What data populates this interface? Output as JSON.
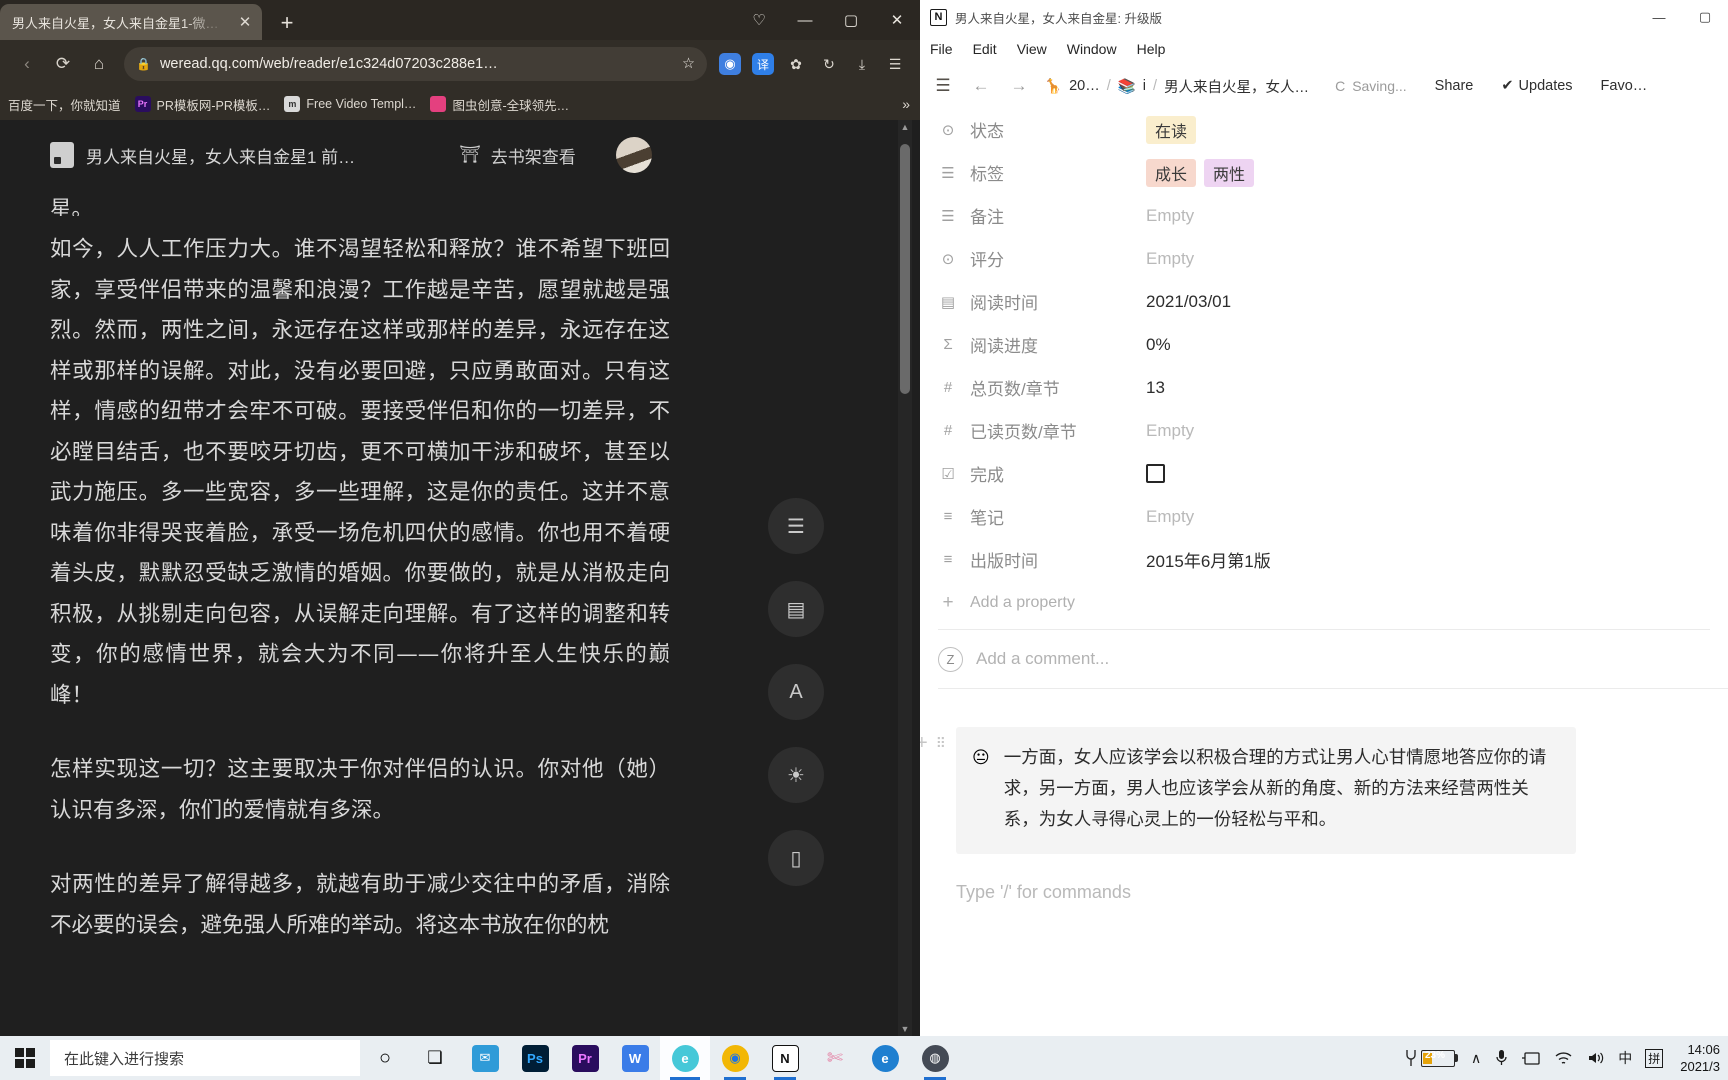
{
  "browser": {
    "tab": {
      "title": "男人来自火星，女人来自金星1-微…",
      "close": "✕"
    },
    "newtab_label": "+",
    "window_controls": {
      "pocket": "♡",
      "minimize": "—",
      "maximize": "▢",
      "close": "✕"
    },
    "nav": {
      "back": "‹",
      "forward": "›",
      "reload": "⟳",
      "home": "⌂"
    },
    "url": {
      "lock": "🔒",
      "text": "weread.qq.com/web/reader/e1c324d07203c288e1…",
      "star": "☆"
    },
    "extensions": [
      {
        "name": "adblock-extension",
        "glyph": "◉"
      },
      {
        "name": "translate-extension",
        "glyph": "译"
      },
      {
        "name": "puzzle-extension",
        "glyph": "✿"
      },
      {
        "name": "history-extension",
        "glyph": "↻"
      },
      {
        "name": "download-button",
        "glyph": "⤓"
      },
      {
        "name": "menu-button",
        "glyph": "☰"
      }
    ],
    "bookmarks": [
      {
        "label": "百度一下，你就知道",
        "icon": "",
        "color": "transparent"
      },
      {
        "label": "PR模板网-PR模板…",
        "icon": "Pr",
        "color": "#2a0d5e"
      },
      {
        "label": "Free Video Templ…",
        "icon": "m",
        "color": "#d9d9d9"
      },
      {
        "label": "图虫创意-全球领先…",
        "icon": "",
        "color": "#e4407f"
      }
    ],
    "bookmarks_overflow": "»"
  },
  "reader": {
    "header": {
      "book_title": "男人来自火星，女人来自金星1 前…",
      "shelf_button": "去书架查看"
    },
    "paragraphs": [
      "星。",
      "如今，人人工作压力大。谁不渴望轻松和释放？谁不希望下班回家，享受伴侣带来的温馨和浪漫？工作越是辛苦，愿望就越是强烈。然而，两性之间，永远存在这样或那样的差异，永远存在这样或那样的误解。对此，没有必要回避，只应勇敢面对。只有这样，情感的纽带才会牢不可破。要接受伴侣和你的一切差异，不必瞠目结舌，也不要咬牙切齿，更不可横加干涉和破坏，甚至以武力施压。多一些宽容，多一些理解，这是你的责任。这并不意味着你非得哭丧着脸，承受一场危机四伏的感情。你也用不着硬着头皮，默默忍受缺乏激情的婚姻。你要做的，就是从消极走向积极，从挑剔走向包容，从误解走向理解。有了这样的调整和转变，你的感情世界，就会大为不同——你将升至人生快乐的巅峰！",
      "怎样实现这一切？这主要取决于你对伴侣的认识。你对他（她）认识有多深，你们的爱情就有多深。",
      "对两性的差异了解得越多，就越有助于减少交往中的矛盾，消除不必要的误会，避免强人所难的举动。将这本书放在你的枕"
    ],
    "float_tools": [
      {
        "name": "catalog-icon",
        "glyph": "☰"
      },
      {
        "name": "comment-icon",
        "glyph": "▤"
      },
      {
        "name": "font-size-icon",
        "glyph": "A"
      },
      {
        "name": "brightness-icon",
        "glyph": "☀"
      },
      {
        "name": "device-icon",
        "glyph": "▯"
      }
    ],
    "scrollbar": {
      "up": "▲",
      "down": "▼"
    }
  },
  "notion": {
    "title": "男人来自火星，女人来自金星: 升级版",
    "window_controls": {
      "minimize": "—",
      "maximize": "▢"
    },
    "menu": [
      "File",
      "Edit",
      "View",
      "Window",
      "Help"
    ],
    "topbar": {
      "sidebar_toggle": "☰",
      "back": "←",
      "forward": "→",
      "breadcrumb": [
        {
          "emoji": "🦒",
          "label": "20…"
        },
        {
          "emoji": "📚",
          "label": "i"
        },
        {
          "emoji": "",
          "label": "男人来自火星，女人…"
        }
      ],
      "saving": "Saving...",
      "saving_spinner": "C",
      "share": "Share",
      "updates": "Updates",
      "updates_check": "✔",
      "favorite": "Favo…"
    },
    "properties": [
      {
        "icon": "⊙",
        "name": "状态",
        "value": "在读",
        "type": "pill",
        "bg": "#faeecd",
        "empty": false
      },
      {
        "icon": "☰",
        "name": "标签",
        "value": "",
        "type": "pills",
        "pills": [
          {
            "text": "成长",
            "bg": "#f7d8cd"
          },
          {
            "text": "两性",
            "bg": "#eed4f2"
          }
        ],
        "empty": false
      },
      {
        "icon": "☰",
        "name": "备注",
        "value": "Empty",
        "type": "text",
        "empty": true
      },
      {
        "icon": "⊙",
        "name": "评分",
        "value": "Empty",
        "type": "text",
        "empty": true
      },
      {
        "icon": "▤",
        "name": "阅读时间",
        "value": "2021/03/01",
        "type": "text",
        "empty": false
      },
      {
        "icon": "Σ",
        "name": "阅读进度",
        "value": "0%",
        "type": "text",
        "empty": false
      },
      {
        "icon": "#",
        "name": "总页数/章节",
        "value": "13",
        "type": "text",
        "empty": false
      },
      {
        "icon": "#",
        "name": "已读页数/章节",
        "value": "Empty",
        "type": "text",
        "empty": true
      },
      {
        "icon": "☑",
        "name": "完成",
        "value": "",
        "type": "checkbox",
        "empty": false
      },
      {
        "icon": "≡",
        "name": "笔记",
        "value": "Empty",
        "type": "text",
        "empty": true
      },
      {
        "icon": "≡",
        "name": "出版时间",
        "value": "2015年6月第1版",
        "type": "text",
        "empty": false
      }
    ],
    "add_property": {
      "icon": "+",
      "label": "Add a property"
    },
    "comment": {
      "avatar": "Z",
      "placeholder": "Add a comment..."
    },
    "callout": {
      "emoji": "😐",
      "text": "一方面，女人应该学会以积极合理的方式让男人心甘情愿地答应你的请求，另一方面，男人也应该学会从新的角度、新的方法来经营两性关系，为女人寻得心灵上的一份轻松与平和。"
    },
    "command_placeholder": "Type '/' for commands",
    "block_handles": {
      "add": "+",
      "drag": "⠿"
    }
  },
  "taskbar": {
    "start": "⊞",
    "search_placeholder": "在此键入进行搜索",
    "items": [
      {
        "name": "cortana-icon",
        "glyph": "○",
        "bg": "transparent",
        "color": "#1c1c1c"
      },
      {
        "name": "task-view-icon",
        "glyph": "❏",
        "bg": "transparent",
        "color": "#1c1c1c"
      },
      {
        "name": "mail-icon",
        "glyph": "✉",
        "bg": "#2f9bd8",
        "color": "#ffffff"
      },
      {
        "name": "photoshop-icon",
        "glyph": "Ps",
        "bg": "#001e36",
        "color": "#31a8ff"
      },
      {
        "name": "premiere-icon",
        "glyph": "Pr",
        "bg": "#2a0d5e",
        "color": "#ea77ff"
      },
      {
        "name": "wps-icon",
        "glyph": "W",
        "bg": "#3a7ce8",
        "color": "#ffffff"
      },
      {
        "name": "browser-2345-icon",
        "glyph": "e",
        "bg": "#46c8d8",
        "color": "#ffffff"
      },
      {
        "name": "chrome-icon",
        "glyph": "◉",
        "bg": "#f2b705",
        "color": "#1a73e8"
      },
      {
        "name": "notion-icon",
        "glyph": "N",
        "bg": "#ffffff",
        "color": "#111111"
      },
      {
        "name": "snipaste-icon",
        "glyph": "✄",
        "bg": "transparent",
        "color": "#e47ba0"
      },
      {
        "name": "edge-icon",
        "glyph": "e",
        "bg": "#1f7fd0",
        "color": "#ffffff"
      },
      {
        "name": "recorder-icon",
        "glyph": "◍",
        "bg": "#444a55",
        "color": "#ffffff"
      }
    ],
    "tray": {
      "battery_pct": "23%",
      "chevron": "∧",
      "mic": "🎤",
      "tablet": "▱",
      "wifi": "⌁",
      "volume": "🔊",
      "ime_lang": "中",
      "ime_mode": "拼",
      "time": "14:06",
      "date": "2021/3"
    }
  }
}
